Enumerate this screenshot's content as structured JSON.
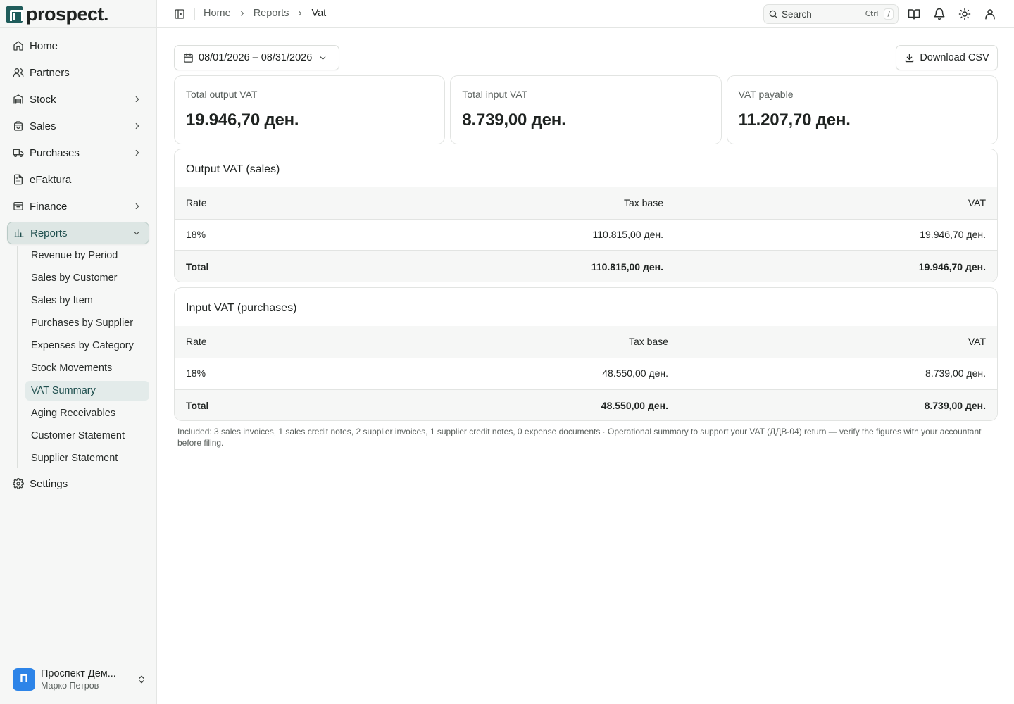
{
  "brand": {
    "name": "prospect."
  },
  "sidebar": {
    "items": [
      {
        "label": "Home",
        "icon": "home-icon"
      },
      {
        "label": "Partners",
        "icon": "users-icon"
      },
      {
        "label": "Stock",
        "icon": "warehouse-icon"
      },
      {
        "label": "Sales",
        "icon": "shopping-bag-icon"
      },
      {
        "label": "Purchases",
        "icon": "truck-icon"
      },
      {
        "label": "eFaktura",
        "icon": "document-icon"
      },
      {
        "label": "Finance",
        "icon": "archive-icon"
      },
      {
        "label": "Reports",
        "icon": "bar-chart-icon"
      },
      {
        "label": "Settings",
        "icon": "gear-icon"
      }
    ],
    "reports_sub": [
      "Revenue by Period",
      "Sales by Customer",
      "Sales by Item",
      "Purchases by Supplier",
      "Expenses by Category",
      "Stock Movements",
      "VAT Summary",
      "Aging Receivables",
      "Customer Statement",
      "Supplier Statement"
    ],
    "active_sub": "VAT Summary"
  },
  "account": {
    "initial": "П",
    "org": "Проспект Дем...",
    "user": "Марко Петров"
  },
  "topbar": {
    "breadcrumb": [
      "Home",
      "Reports",
      "Vat"
    ],
    "search": {
      "label": "Search",
      "key1": "Ctrl",
      "key2": "/"
    }
  },
  "toolbar": {
    "date_range": "08/01/2026 – 08/31/2026",
    "download_label": "Download CSV"
  },
  "cards": [
    {
      "label": "Total output VAT",
      "value": "19.946,70 ден."
    },
    {
      "label": "Total input VAT",
      "value": "8.739,00 ден."
    },
    {
      "label": "VAT payable",
      "value": "11.207,70 ден."
    }
  ],
  "output_section": {
    "title": "Output VAT (sales)",
    "headers": {
      "rate": "Rate",
      "base": "Tax base",
      "vat": "VAT"
    },
    "rows": [
      {
        "rate": "18%",
        "base": "110.815,00 ден.",
        "vat": "19.946,70 ден."
      }
    ],
    "total": {
      "label": "Total",
      "base": "110.815,00 ден.",
      "vat": "19.946,70 ден."
    }
  },
  "input_section": {
    "title": "Input VAT (purchases)",
    "headers": {
      "rate": "Rate",
      "base": "Tax base",
      "vat": "VAT"
    },
    "rows": [
      {
        "rate": "18%",
        "base": "48.550,00 ден.",
        "vat": "8.739,00 ден."
      }
    ],
    "total": {
      "label": "Total",
      "base": "48.550,00 ден.",
      "vat": "8.739,00 ден."
    }
  },
  "note": "Included: 3 sales invoices, 1 sales credit notes, 2 supplier invoices, 1 supplier credit notes, 0 expense documents · Operational summary to support your VAT (ДДВ-04) return — verify the figures with your accountant before filing.",
  "colors": {
    "accent": "#1f5c5b",
    "active_bg": "#dde6e4",
    "avatar": "#2d84e8",
    "sidebar_bg": "#f6f7f6"
  }
}
